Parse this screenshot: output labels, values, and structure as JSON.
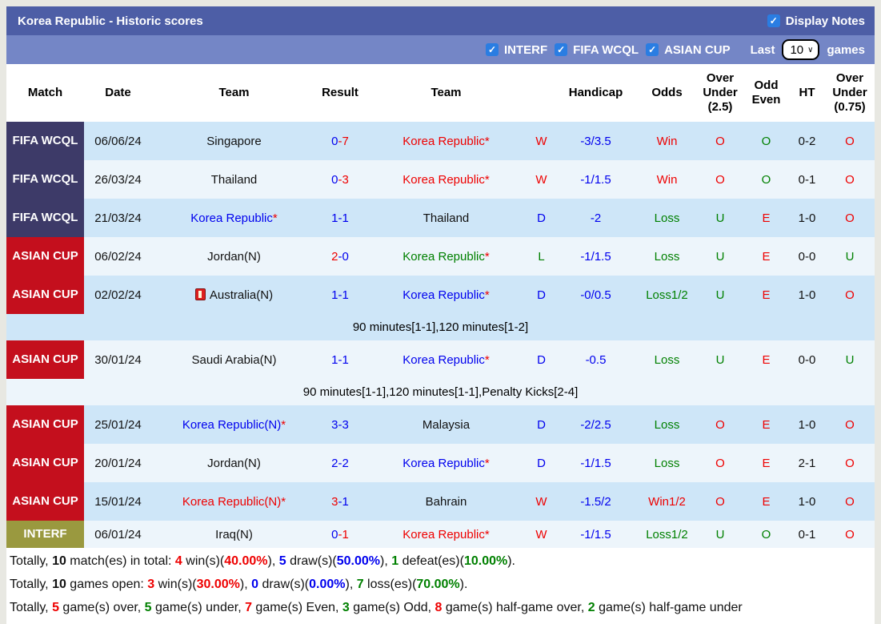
{
  "colors": {
    "frame": "#e8e8e2",
    "title_bar": "#4d5ea6",
    "filter_bar": "#7486c6",
    "checkbox": "#2a7de2",
    "row_blue": "#cee6f8",
    "row_light": "#edf5fb",
    "badge_fifa": "#3d3a68",
    "badge_asian": "#c40f1d",
    "badge_interf": "#9a993f",
    "red": "#ee0000",
    "green": "#008000",
    "blue": "#0000ee"
  },
  "icons": {
    "check": "✓",
    "caret": "∨"
  },
  "title_bar": {
    "title": "Korea Republic - Historic scores",
    "display_notes_label": "Display Notes",
    "display_notes_checked": true
  },
  "filter_bar": {
    "filters": [
      {
        "label": "INTERF",
        "checked": true
      },
      {
        "label": "FIFA WCQL",
        "checked": true
      },
      {
        "label": "ASIAN CUP",
        "checked": true
      }
    ],
    "last_label": "Last",
    "last_value": "10",
    "games_label": "games"
  },
  "table": {
    "headers": [
      "Match",
      "Date",
      "Team",
      "Result",
      "Team",
      "",
      "Handicap",
      "Odds",
      "Over Under (2.5)",
      "Odd Even",
      "HT",
      "Over Under (0.75)"
    ],
    "rows": [
      {
        "competition": "FIFA WCQL",
        "comp_type": "fifa",
        "date": "06/06/24",
        "team1": {
          "name": "Singapore",
          "color": "black",
          "star": false
        },
        "result": {
          "s1": "0",
          "s1_color": "blue",
          "s2": "7",
          "s2_color": "red"
        },
        "team2": {
          "name": "Korea Republic",
          "color": "red",
          "star": true
        },
        "wdl": {
          "text": "W",
          "color": "red"
        },
        "handicap": "-3/3.5",
        "odds": {
          "text": "Win",
          "color": "red"
        },
        "over_under_25": {
          "text": "O",
          "color": "red"
        },
        "odd_even": {
          "text": "O",
          "color": "green"
        },
        "ht": "0-2",
        "over_under_075": {
          "text": "O",
          "color": "red"
        },
        "note": null
      },
      {
        "competition": "FIFA WCQL",
        "comp_type": "fifa",
        "date": "26/03/24",
        "team1": {
          "name": "Thailand",
          "color": "black",
          "star": false
        },
        "result": {
          "s1": "0",
          "s1_color": "blue",
          "s2": "3",
          "s2_color": "red"
        },
        "team2": {
          "name": "Korea Republic",
          "color": "red",
          "star": true
        },
        "wdl": {
          "text": "W",
          "color": "red"
        },
        "handicap": "-1/1.5",
        "odds": {
          "text": "Win",
          "color": "red"
        },
        "over_under_25": {
          "text": "O",
          "color": "red"
        },
        "odd_even": {
          "text": "O",
          "color": "green"
        },
        "ht": "0-1",
        "over_under_075": {
          "text": "O",
          "color": "red"
        },
        "note": null
      },
      {
        "competition": "FIFA WCQL",
        "comp_type": "fifa",
        "date": "21/03/24",
        "team1": {
          "name": "Korea Republic",
          "color": "blue",
          "star": true
        },
        "result": {
          "s1": "1",
          "s1_color": "blue",
          "s2": "1",
          "s2_color": "blue"
        },
        "team2": {
          "name": "Thailand",
          "color": "black",
          "star": false
        },
        "wdl": {
          "text": "D",
          "color": "blue"
        },
        "handicap": "-2",
        "odds": {
          "text": "Loss",
          "color": "green"
        },
        "over_under_25": {
          "text": "U",
          "color": "green"
        },
        "odd_even": {
          "text": "E",
          "color": "red"
        },
        "ht": "1-0",
        "over_under_075": {
          "text": "O",
          "color": "red"
        },
        "note": null
      },
      {
        "competition": "ASIAN CUP",
        "comp_type": "asian",
        "date": "06/02/24",
        "team1": {
          "name": "Jordan(N)",
          "color": "black",
          "star": false
        },
        "result": {
          "s1": "2",
          "s1_color": "red",
          "s2": "0",
          "s2_color": "blue"
        },
        "team2": {
          "name": "Korea Republic",
          "color": "green",
          "star": true
        },
        "wdl": {
          "text": "L",
          "color": "green"
        },
        "handicap": "-1/1.5",
        "odds": {
          "text": "Loss",
          "color": "green"
        },
        "over_under_25": {
          "text": "U",
          "color": "green"
        },
        "odd_even": {
          "text": "E",
          "color": "red"
        },
        "ht": "0-0",
        "over_under_075": {
          "text": "U",
          "color": "green"
        },
        "note": null
      },
      {
        "competition": "ASIAN CUP",
        "comp_type": "asian",
        "date": "02/02/24",
        "team1": {
          "name": "Australia(N)",
          "color": "black",
          "star": false,
          "icon": "media-icon"
        },
        "result": {
          "s1": "1",
          "s1_color": "blue",
          "s2": "1",
          "s2_color": "blue"
        },
        "team2": {
          "name": "Korea Republic",
          "color": "blue",
          "star": true
        },
        "wdl": {
          "text": "D",
          "color": "blue"
        },
        "handicap": "-0/0.5",
        "odds": {
          "text": "Loss1/2",
          "color": "green"
        },
        "over_under_25": {
          "text": "U",
          "color": "green"
        },
        "odd_even": {
          "text": "E",
          "color": "red"
        },
        "ht": "1-0",
        "over_under_075": {
          "text": "O",
          "color": "red"
        },
        "note": "90 minutes[1-1],120 minutes[1-2]"
      },
      {
        "competition": "ASIAN CUP",
        "comp_type": "asian",
        "date": "30/01/24",
        "team1": {
          "name": "Saudi Arabia(N)",
          "color": "black",
          "star": false
        },
        "result": {
          "s1": "1",
          "s1_color": "blue",
          "s2": "1",
          "s2_color": "blue"
        },
        "team2": {
          "name": "Korea Republic",
          "color": "blue",
          "star": true
        },
        "wdl": {
          "text": "D",
          "color": "blue"
        },
        "handicap": "-0.5",
        "odds": {
          "text": "Loss",
          "color": "green"
        },
        "over_under_25": {
          "text": "U",
          "color": "green"
        },
        "odd_even": {
          "text": "E",
          "color": "red"
        },
        "ht": "0-0",
        "over_under_075": {
          "text": "U",
          "color": "green"
        },
        "note": "90 minutes[1-1],120 minutes[1-1],Penalty Kicks[2-4]"
      },
      {
        "competition": "ASIAN CUP",
        "comp_type": "asian",
        "date": "25/01/24",
        "team1": {
          "name": "Korea Republic(N)",
          "color": "blue",
          "star": true
        },
        "result": {
          "s1": "3",
          "s1_color": "blue",
          "s2": "3",
          "s2_color": "blue"
        },
        "team2": {
          "name": "Malaysia",
          "color": "black",
          "star": false
        },
        "wdl": {
          "text": "D",
          "color": "blue"
        },
        "handicap": "-2/2.5",
        "odds": {
          "text": "Loss",
          "color": "green"
        },
        "over_under_25": {
          "text": "O",
          "color": "red"
        },
        "odd_even": {
          "text": "E",
          "color": "red"
        },
        "ht": "1-0",
        "over_under_075": {
          "text": "O",
          "color": "red"
        },
        "note": null
      },
      {
        "competition": "ASIAN CUP",
        "comp_type": "asian",
        "date": "20/01/24",
        "team1": {
          "name": "Jordan(N)",
          "color": "black",
          "star": false
        },
        "result": {
          "s1": "2",
          "s1_color": "blue",
          "s2": "2",
          "s2_color": "blue"
        },
        "team2": {
          "name": "Korea Republic",
          "color": "blue",
          "star": true
        },
        "wdl": {
          "text": "D",
          "color": "blue"
        },
        "handicap": "-1/1.5",
        "odds": {
          "text": "Loss",
          "color": "green"
        },
        "over_under_25": {
          "text": "O",
          "color": "red"
        },
        "odd_even": {
          "text": "E",
          "color": "red"
        },
        "ht": "2-1",
        "over_under_075": {
          "text": "O",
          "color": "red"
        },
        "note": null
      },
      {
        "competition": "ASIAN CUP",
        "comp_type": "asian",
        "date": "15/01/24",
        "team1": {
          "name": "Korea Republic(N)",
          "color": "red",
          "star": true
        },
        "result": {
          "s1": "3",
          "s1_color": "red",
          "s2": "1",
          "s2_color": "blue"
        },
        "team2": {
          "name": "Bahrain",
          "color": "black",
          "star": false
        },
        "wdl": {
          "text": "W",
          "color": "red"
        },
        "handicap": "-1.5/2",
        "odds": {
          "text": "Win1/2",
          "color": "red"
        },
        "over_under_25": {
          "text": "O",
          "color": "red"
        },
        "odd_even": {
          "text": "E",
          "color": "red"
        },
        "ht": "1-0",
        "over_under_075": {
          "text": "O",
          "color": "red"
        },
        "note": null
      },
      {
        "competition": "INTERF",
        "comp_type": "interf",
        "date": "06/01/24",
        "team1": {
          "name": "Iraq(N)",
          "color": "black",
          "star": false
        },
        "result": {
          "s1": "0",
          "s1_color": "blue",
          "s2": "1",
          "s2_color": "red"
        },
        "team2": {
          "name": "Korea Republic",
          "color": "red",
          "star": true
        },
        "wdl": {
          "text": "W",
          "color": "red"
        },
        "handicap": "-1/1.5",
        "odds": {
          "text": "Loss1/2",
          "color": "green"
        },
        "over_under_25": {
          "text": "U",
          "color": "green"
        },
        "odd_even": {
          "text": "O",
          "color": "green"
        },
        "ht": "0-1",
        "over_under_075": {
          "text": "O",
          "color": "red"
        },
        "note": null
      }
    ]
  },
  "footer": {
    "lines": [
      [
        {
          "t": "Totally, ",
          "c": "black",
          "b": false
        },
        {
          "t": "10",
          "c": "black",
          "b": true
        },
        {
          "t": " match(es) in total: ",
          "c": "black",
          "b": false
        },
        {
          "t": "4",
          "c": "red",
          "b": true
        },
        {
          "t": " win(s)(",
          "c": "black",
          "b": false
        },
        {
          "t": "40.00%",
          "c": "red",
          "b": true
        },
        {
          "t": "), ",
          "c": "black",
          "b": false
        },
        {
          "t": "5",
          "c": "blue",
          "b": true
        },
        {
          "t": " draw(s)(",
          "c": "black",
          "b": false
        },
        {
          "t": "50.00%",
          "c": "blue",
          "b": true
        },
        {
          "t": "), ",
          "c": "black",
          "b": false
        },
        {
          "t": "1",
          "c": "green",
          "b": true
        },
        {
          "t": " defeat(es)(",
          "c": "black",
          "b": false
        },
        {
          "t": "10.00%",
          "c": "green",
          "b": true
        },
        {
          "t": ").",
          "c": "black",
          "b": false
        }
      ],
      [
        {
          "t": "Totally, ",
          "c": "black",
          "b": false
        },
        {
          "t": "10",
          "c": "black",
          "b": true
        },
        {
          "t": " games open: ",
          "c": "black",
          "b": false
        },
        {
          "t": "3",
          "c": "red",
          "b": true
        },
        {
          "t": " win(s)(",
          "c": "black",
          "b": false
        },
        {
          "t": "30.00%",
          "c": "red",
          "b": true
        },
        {
          "t": "), ",
          "c": "black",
          "b": false
        },
        {
          "t": "0",
          "c": "blue",
          "b": true
        },
        {
          "t": " draw(s)(",
          "c": "black",
          "b": false
        },
        {
          "t": "0.00%",
          "c": "blue",
          "b": true
        },
        {
          "t": "), ",
          "c": "black",
          "b": false
        },
        {
          "t": "7",
          "c": "green",
          "b": true
        },
        {
          "t": " loss(es)(",
          "c": "black",
          "b": false
        },
        {
          "t": "70.00%",
          "c": "green",
          "b": true
        },
        {
          "t": ").",
          "c": "black",
          "b": false
        }
      ],
      [
        {
          "t": "Totally, ",
          "c": "black",
          "b": false
        },
        {
          "t": "5",
          "c": "red",
          "b": true
        },
        {
          "t": " game(s) over, ",
          "c": "black",
          "b": false
        },
        {
          "t": "5",
          "c": "green",
          "b": true
        },
        {
          "t": " game(s) under, ",
          "c": "black",
          "b": false
        },
        {
          "t": "7",
          "c": "red",
          "b": true
        },
        {
          "t": " game(s) Even, ",
          "c": "black",
          "b": false
        },
        {
          "t": "3",
          "c": "green",
          "b": true
        },
        {
          "t": " game(s) Odd, ",
          "c": "black",
          "b": false
        },
        {
          "t": "8",
          "c": "red",
          "b": true
        },
        {
          "t": " game(s) half-game over, ",
          "c": "black",
          "b": false
        },
        {
          "t": "2",
          "c": "green",
          "b": true
        },
        {
          "t": " game(s) half-game under",
          "c": "black",
          "b": false
        }
      ]
    ]
  }
}
